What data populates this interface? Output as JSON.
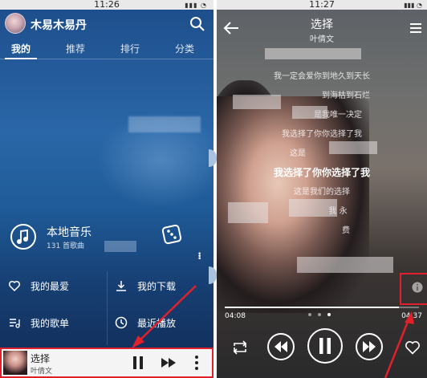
{
  "left": {
    "status_time": "11:26",
    "username": "木易木易丹",
    "tabs": [
      {
        "label": "我的",
        "active": true
      },
      {
        "label": "推荐",
        "active": false
      },
      {
        "label": "排行",
        "active": false
      },
      {
        "label": "分类",
        "active": false
      }
    ],
    "local_music": {
      "title": "本地音乐",
      "count": "131 首歌曲"
    },
    "menu": [
      {
        "label": "我的最爱",
        "icon": "heart-icon"
      },
      {
        "label": "我的下载",
        "icon": "download-icon"
      },
      {
        "label": "我的歌单",
        "icon": "playlist-icon"
      },
      {
        "label": "最近播放",
        "icon": "history-icon"
      }
    ],
    "mini_player": {
      "title": "选择",
      "artist": "叶倩文"
    }
  },
  "right": {
    "status_time": "11:27",
    "title": "选择",
    "artist": "叶倩文",
    "lyrics": [
      {
        "text": "我一定会爱你到地久到天长",
        "current": false
      },
      {
        "text": "到海枯到石烂",
        "current": false
      },
      {
        "text": "是我唯一决定",
        "current": false
      },
      {
        "text": "我选择了你你选择了我",
        "current": false
      },
      {
        "text": "这是",
        "current": false
      },
      {
        "text": "我选择了你你选择了我",
        "current": true
      },
      {
        "text": "这是我们的选择",
        "current": false
      },
      {
        "text": "我 永",
        "current": false
      },
      {
        "text": "费",
        "current": false
      }
    ],
    "time_current": "04:08",
    "time_total": "04:37",
    "progress": 0.895
  },
  "colors": {
    "highlight": "#e0202a",
    "left_bg": "#1f5b98",
    "right_bg": "#3b3533"
  }
}
